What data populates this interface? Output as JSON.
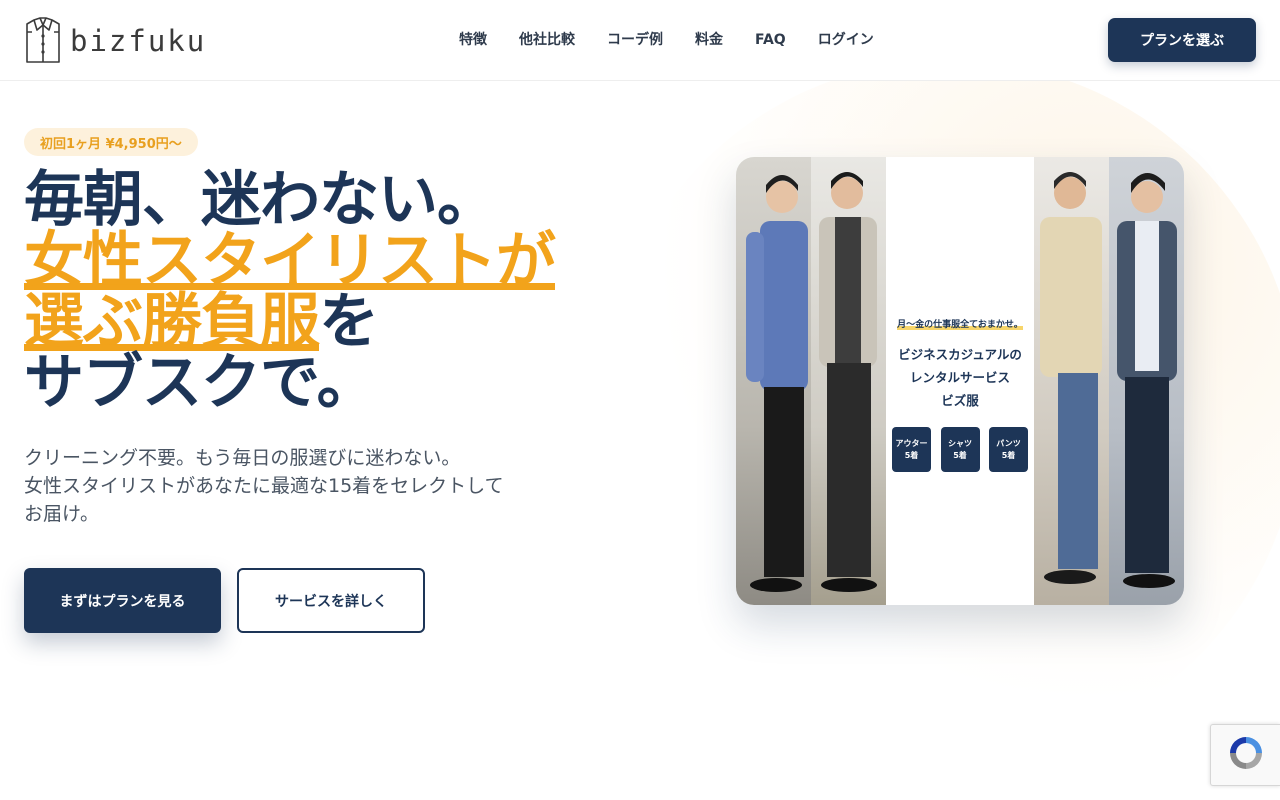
{
  "header": {
    "logo_text": "bizfuku",
    "nav": [
      "特徴",
      "他社比較",
      "コーデ例",
      "料金",
      "FAQ",
      "ログイン"
    ],
    "cta_label": "プランを選ぶ"
  },
  "hero": {
    "badge": "初回1ヶ月 ¥4,950円〜",
    "headline": {
      "line1": "毎朝、迷わない。",
      "line2": "女性スタイリストが",
      "line3_highlight": "選ぶ勝負服",
      "line3_rest": "を",
      "line4": "サブスクで。"
    },
    "lead": {
      "line1": "クリーニング不要。もう毎日の服選びに迷わない。",
      "line2": "女性スタイリストがあなたに最適な15着をセレクトして",
      "line3": "お届け。"
    },
    "primary_cta": "まずはプランを見る",
    "secondary_cta": "サービスを詳しく"
  },
  "hero_image": {
    "tagline": "月〜金の仕事服全ておまかせ。",
    "title_line1": "ビジネスカジュアルの",
    "title_line2": "レンタルサービス",
    "title_line3": "ビズ服",
    "pills": [
      {
        "name": "アウター",
        "count": "5着"
      },
      {
        "name": "シャツ",
        "count": "5着"
      },
      {
        "name": "パンツ",
        "count": "5着"
      }
    ]
  },
  "colors": {
    "navy": "#1d3557",
    "accent": "#f2a31b",
    "badge_bg": "#fdf1dc"
  },
  "icons": [
    "shirt-logo-icon",
    "recaptcha-icon"
  ]
}
